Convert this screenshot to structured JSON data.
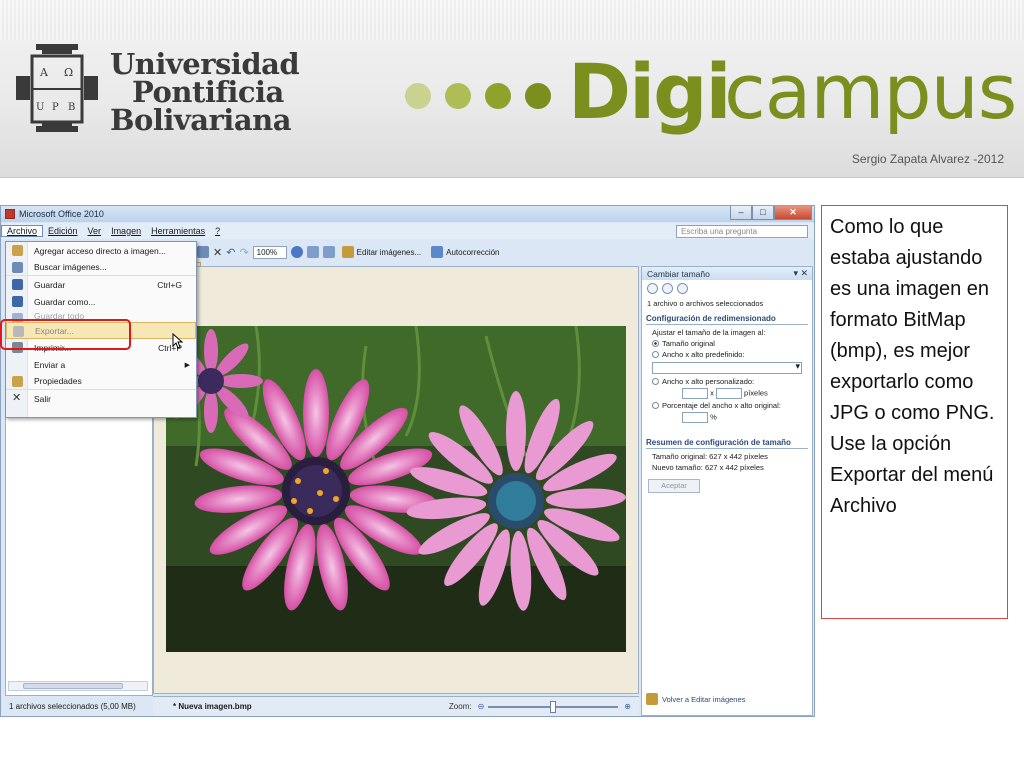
{
  "banner": {
    "university_lines": [
      "Universidad",
      "Pontificia",
      "Bolivariana"
    ],
    "crest_letters": [
      "A",
      "Ω",
      "U",
      "P",
      "B"
    ],
    "brand_bold": "Digi",
    "brand_light": "campus",
    "author": "Sergio Zapata Alvarez -2012",
    "brand_color": "#7a8f1e"
  },
  "window": {
    "title": "Microsoft Office 2010",
    "menu": [
      "Archivo",
      "Edición",
      "Ver",
      "Imagen",
      "Herramientas",
      "?"
    ],
    "search_placeholder": "Escriba una pregunta",
    "toolbar": {
      "zoom": "100%",
      "edit_images": "Editar imágenes...",
      "autocorrect": "Autocorrección"
    },
    "file_menu": [
      {
        "label": "Agregar acceso directo a imagen...",
        "shortcut": "",
        "icon": "shortcut-icon"
      },
      {
        "label": "Buscar imágenes...",
        "shortcut": "",
        "icon": "search-icon"
      },
      {
        "label": "Guardar",
        "shortcut": "Ctrl+G",
        "icon": "save-icon"
      },
      {
        "label": "Guardar como...",
        "shortcut": "",
        "icon": "save-as-icon"
      },
      {
        "label": "Guardar todo",
        "shortcut": "",
        "icon": "save-all-icon"
      },
      {
        "label": "Exportar...",
        "shortcut": "",
        "icon": "export-icon"
      },
      {
        "label": "Imprimir...",
        "shortcut": "Ctrl+P",
        "icon": "print-icon"
      },
      {
        "label": "Enviar a",
        "shortcut": "",
        "icon": ""
      },
      {
        "label": "Propiedades",
        "shortcut": "",
        "icon": "properties-icon"
      },
      {
        "label": "Salir",
        "shortcut": "",
        "icon": "close-icon"
      }
    ],
    "status_left": "1 archivos seleccionados (5,00 MB)",
    "file_name": "* Nueva imagen.bmp",
    "zoom_label": "Zoom:",
    "task_pane": {
      "title": "Cambiar tamaño",
      "selected": "1 archivo o archivos seleccionados",
      "section1": "Configuración de redimensionado",
      "adjust_label": "Ajustar el tamaño de la imagen al:",
      "opt_original": "Tamaño original",
      "opt_predefined": "Ancho x alto predefinido:",
      "opt_custom": "Ancho x alto personalizado:",
      "x_sep": "x",
      "pixels": "píxeles",
      "opt_percent": "Porcentaje del ancho x alto original:",
      "percent_sign": "%",
      "section2": "Resumen de configuración de tamaño",
      "orig_label": "Tamaño original:",
      "orig_value": "627 x 442 píxeles",
      "new_label": "Nuevo tamaño:",
      "new_value": "627 x 442 píxeles",
      "accept": "Aceptar",
      "back_link": "Volver a Editar imágenes"
    }
  },
  "callout": {
    "text": "Como lo que estaba ajustando es una imagen en formato BitMap (bmp), es mejor exportarlo como JPG o como PNG. Use la opción Exportar del menú Archivo"
  }
}
